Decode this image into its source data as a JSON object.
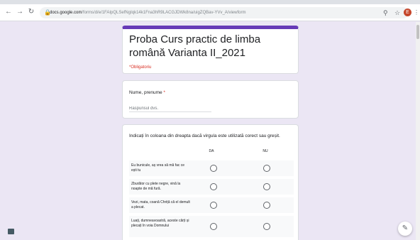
{
  "browser": {
    "back_icon": "arrow-left",
    "forward_icon": "arrow-right",
    "reload_icon": "reload",
    "url_host": "docs.google.com",
    "url_path": "/forms/d/e/1FAIpQLSefNgIqk14k1Fna3hR9LACGJDWk8na/uigZQBav-YVv_A/viewform",
    "avatar_letter": "E"
  },
  "form": {
    "title": "Proba Curs practic de limba română Varianta II_2021",
    "required_note": "*Obligatoriu",
    "name_question": {
      "label": "Nume, prenume",
      "required_mark": "*",
      "placeholder": "Răspunsul dvs."
    },
    "grid_question": {
      "text": "Indicați în coloana din dreapta dacă virgula este utilizată corect sau greșit.",
      "columns": [
        "DA",
        "NU"
      ],
      "rows": [
        "Eu bunicule, aș vrea să mă fac ce ești tu",
        "Zburător cu plete negre, vină la noapte de mă fură.",
        "Vezi, mata, coană Chriță că el demult a plecat.",
        "Luați, dumneavoastră, aceste cărți și plecați în voia Domnului"
      ]
    }
  },
  "colors": {
    "accent": "#673ab7",
    "background": "#ebe6f4",
    "required": "#d93025"
  }
}
